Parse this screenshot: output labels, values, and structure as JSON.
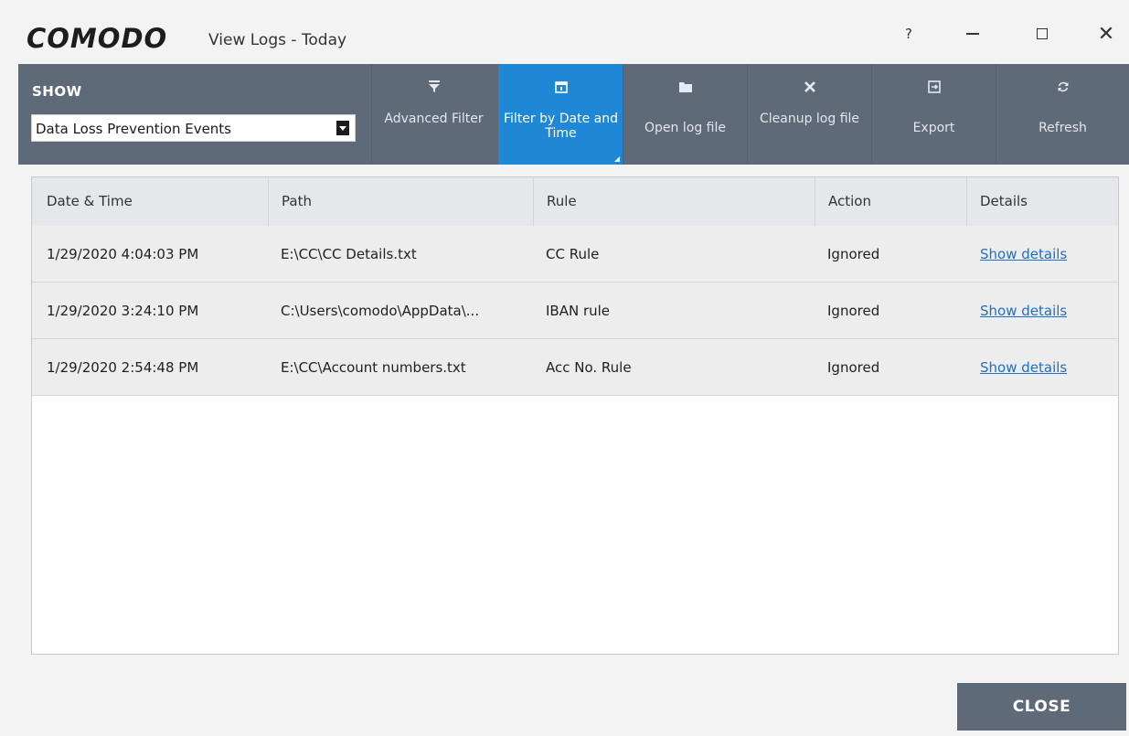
{
  "window": {
    "logo": "COMODO",
    "title": "View Logs - Today",
    "help": "?",
    "close_glyph": "✕"
  },
  "toolbar": {
    "show_label": "SHOW",
    "show_value": "Data Loss Prevention Events",
    "buttons": [
      {
        "label": "Advanced Filter",
        "icon": "filter-icon",
        "active": false
      },
      {
        "label": "Filter by Date and Time",
        "icon": "calendar-icon",
        "active": true
      },
      {
        "label": "Open log file",
        "icon": "folder-icon",
        "active": false
      },
      {
        "label": "Cleanup log file",
        "icon": "x-icon",
        "active": false
      },
      {
        "label": "Export",
        "icon": "export-icon",
        "active": false
      },
      {
        "label": "Refresh",
        "icon": "refresh-icon",
        "active": false
      }
    ]
  },
  "table": {
    "columns": [
      "Date & Time",
      "Path",
      "Rule",
      "Action",
      "Details"
    ],
    "rows": [
      [
        "1/29/2020 4:04:03 PM",
        "E:\\CC\\CC Details.txt",
        "CC Rule",
        "Ignored",
        "Show details"
      ],
      [
        "1/29/2020 3:24:10 PM",
        "C:\\Users\\comodo\\AppData\\...",
        "IBAN rule",
        "Ignored",
        "Show details"
      ],
      [
        "1/29/2020 2:54:48 PM",
        "E:\\CC\\Account numbers.txt",
        "Acc No. Rule",
        "Ignored",
        "Show details"
      ]
    ]
  },
  "footer": {
    "close_label": "CLOSE"
  },
  "colors": {
    "toolbar_bg": "#5f6a78",
    "active_button": "#1e88d6",
    "link": "#1f6fc5"
  }
}
